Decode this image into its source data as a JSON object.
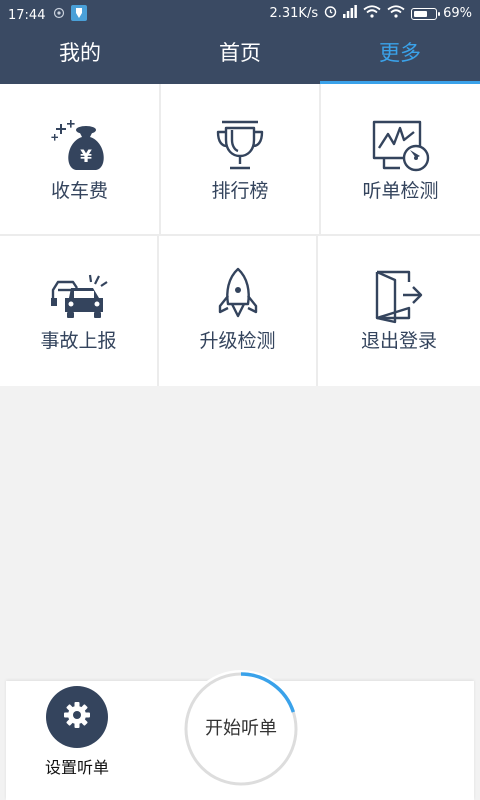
{
  "status_bar": {
    "time": "17:44",
    "network_speed": "2.31K/s",
    "battery_percent": "69%",
    "battery_level": 0.69,
    "icons": [
      "location-icon",
      "app-notification-icon",
      "alarm-icon",
      "signal-icon",
      "wifi-icon",
      "wifi-icon",
      "battery-icon"
    ]
  },
  "tabs": [
    {
      "label": "我的",
      "active": false
    },
    {
      "label": "首页",
      "active": false
    },
    {
      "label": "更多",
      "active": true
    }
  ],
  "colors": {
    "header_bg": "#3a4a63",
    "accent": "#3aa2ea",
    "icon_dark": "#34445d",
    "page_bg": "#f2f2f2"
  },
  "grid": [
    {
      "label": "收车费",
      "icon": "money-bag-icon"
    },
    {
      "label": "排行榜",
      "icon": "trophy-icon"
    },
    {
      "label": "听单检测",
      "icon": "monitor-check-icon"
    },
    {
      "label": "事故上报",
      "icon": "car-accident-icon"
    },
    {
      "label": "升级检测",
      "icon": "rocket-icon"
    },
    {
      "label": "退出登录",
      "icon": "logout-door-icon"
    }
  ],
  "bottom": {
    "settings_label": "设置听单",
    "settings_icon": "gear-icon",
    "start_label": "开始听单",
    "start_progress": 0.2
  }
}
